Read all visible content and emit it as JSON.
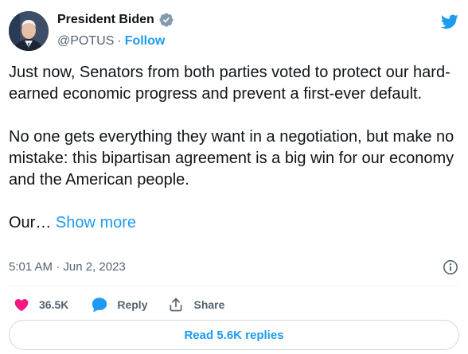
{
  "author": {
    "display_name": "President Biden",
    "handle": "@POTUS",
    "separator": "·",
    "follow_label": "Follow"
  },
  "tweet": {
    "paragraph_1": "Just now, Senators from both parties voted to protect our hard-earned economic progress and prevent a first-ever default.",
    "paragraph_2": "No one gets everything they want in a negotiation, but make no mistake: this bipartisan agreement is a big win for our economy and the American people.",
    "paragraph_3_truncated": "Our… ",
    "show_more_label": "Show more"
  },
  "meta": {
    "timestamp": "5:01 AM · Jun 2, 2023"
  },
  "actions": {
    "like_count": "36.5K",
    "reply_label": "Reply",
    "share_label": "Share"
  },
  "read_replies_label": "Read 5.6K replies",
  "colors": {
    "accent": "#1d9bf0",
    "like": "#f91880",
    "text": "#0f1419",
    "muted": "#536471"
  },
  "icons": {
    "bird": "twitter-bird-icon",
    "verified": "verified-badge-icon",
    "info": "info-icon",
    "like": "heart-icon",
    "reply": "speech-bubble-icon",
    "share": "share-upload-icon"
  }
}
